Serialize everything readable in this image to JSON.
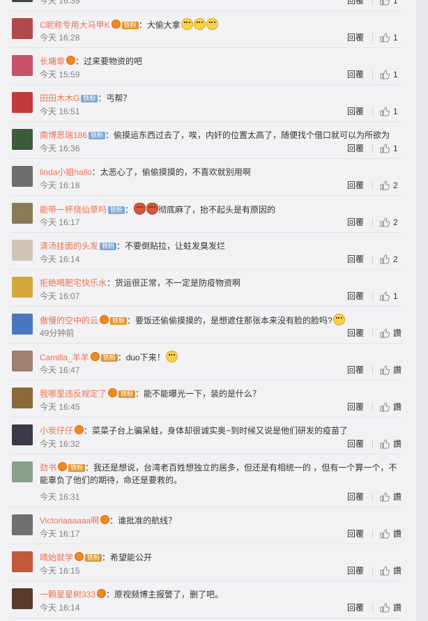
{
  "labels": {
    "reply": "回覆",
    "like_text": "讚"
  },
  "comments": [
    {
      "avatar_color": "#3b4a3e",
      "name": "",
      "vip": false,
      "fan": "",
      "text": "",
      "emoji": [],
      "time": "今天 16:39",
      "likes": "1",
      "like_style": "icon"
    },
    {
      "avatar_color": "#b04a4a",
      "name": "C昵称专用大马甲K",
      "vip": true,
      "fan": "铁粉",
      "fan_style": "gold",
      "text": "：大偷大拿",
      "emoji": [
        "surprised",
        "surprised",
        "surprised"
      ],
      "time": "今天 16:28",
      "likes": "1",
      "like_style": "icon"
    },
    {
      "avatar_color": "#c8516a",
      "name": "长墉章",
      "vip": true,
      "fan": "",
      "text": "：过来要物资的吧",
      "emoji": [],
      "time": "今天 15:59",
      "likes": "1",
      "like_style": "icon"
    },
    {
      "avatar_color": "#c23a3a",
      "name": "田田木木G",
      "vip": false,
      "fan": "铁粉",
      "fan_style": "iron",
      "text": "：丐帮？",
      "emoji": [],
      "time": "今天 16:51",
      "likes": "1",
      "like_style": "icon"
    },
    {
      "avatar_color": "#3d5a3a",
      "name": "南博思瑞186",
      "vip": false,
      "fan": "铁粉",
      "fan_style": "iron",
      "text": "：偷摸运东西过去了，唉，内奸的位置太高了，随便找个借口就可以为所欲为",
      "emoji": [],
      "time": "今天 16:36",
      "likes": "1",
      "like_style": "icon"
    },
    {
      "avatar_color": "#6d6d6d",
      "name": "linda小姐hallo",
      "vip": false,
      "fan": "",
      "text": "：太恶心了，偷偷摸摸的，不喜欢就别用啊",
      "emoji": [],
      "time": "今天 16:18",
      "likes": "2",
      "like_style": "icon"
    },
    {
      "avatar_color": "#8a7a5a",
      "name": "能带一杯烧仙草吗",
      "vip": false,
      "fan": "铁粉",
      "fan_style": "iron",
      "text": "彻底麻了，抬不起头是有原因的",
      "emoji_before": [
        "red",
        "red"
      ],
      "emoji": [],
      "time": "今天 16:17",
      "likes": "2",
      "like_style": "icon"
    },
    {
      "avatar_color": "#cfc6b8",
      "name": "清汤挂面的头发",
      "vip": false,
      "fan": "铁粉",
      "fan_style": "iron",
      "text": "：不要倒贴拉，让蛀发臭发烂",
      "emoji": [],
      "time": "今天 16:14",
      "likes": "2",
      "like_style": "icon"
    },
    {
      "avatar_color": "#d4a83a",
      "name": "拒绝喝肥宅快乐水",
      "vip": false,
      "fan": "",
      "text": "：货运很正常，不一定是防疫物资啊",
      "emoji": [],
      "time": "今天 16:07",
      "likes": "1",
      "like_style": "icon"
    },
    {
      "avatar_color": "#4a78c0",
      "name": "傲慢的空中的云",
      "vip": true,
      "fan": "铁粉",
      "fan_style": "gold",
      "text": "：要饭还偷偷摸摸的，是想遮住那张本来没有脸的脸吗?",
      "emoji": [
        "surprised"
      ],
      "time": "49分钟前",
      "likes": "讚",
      "like_style": "text"
    },
    {
      "avatar_color": "#a08070",
      "name": "Camilla_羊羊",
      "vip": true,
      "fan": "铁粉",
      "fan_style": "gold",
      "text": "：duo下来！",
      "emoji": [
        "surprised"
      ],
      "time": "今天 16:47",
      "likes": "讚",
      "like_style": "text"
    },
    {
      "avatar_color": "#8a6a3a",
      "name": "我哪里违反规定了",
      "vip": true,
      "fan": "铁粉",
      "fan_style": "gold",
      "text": "：能不能曝光一下，装的是什么？",
      "emoji": [],
      "time": "今天 16:45",
      "likes": "讚",
      "like_style": "text"
    },
    {
      "avatar_color": "#3a3a4a",
      "name": "小炭仔仔",
      "vip": true,
      "fan": "",
      "text": "：菜菜子台上骗呆蛙，身体却很诚实奥~到时候又说是他们研发的疫苗了",
      "emoji": [],
      "time": "今天 16:32",
      "likes": "讚",
      "like_style": "text"
    },
    {
      "avatar_color": "#8aa08a",
      "name": "劲书",
      "vip": true,
      "fan": "铁粉",
      "fan_style": "gold",
      "text": "：我还是想说，台湾老百姓想独立的居多，但还是有相统一的 ，但有一个算一个，不能辜负了他们的期待，命还是要救的。",
      "emoji": [],
      "time": "今天 16:31",
      "likes": "讚",
      "like_style": "text",
      "tall": true
    },
    {
      "avatar_color": "#707070",
      "name": "Victoriaaaaaa啊",
      "vip": true,
      "fan": "",
      "text": "：谁批准的航线？",
      "emoji": [],
      "time": "今天 16:17",
      "likes": "讚",
      "like_style": "text"
    },
    {
      "avatar_color": "#c05a3a",
      "name": "晴始就学",
      "vip": true,
      "fan": "铁粉",
      "fan_style": "gold",
      "text": "：希望能公开",
      "emoji": [],
      "time": "今天 16:15",
      "likes": "讚",
      "like_style": "text"
    },
    {
      "avatar_color": "#5a3a2a",
      "name": "一颗星星树333",
      "vip": true,
      "fan": "",
      "text": "：原视频博主报警了，删了吧。",
      "emoji": [],
      "time": "今天 16:14",
      "likes": "讚",
      "like_style": "text"
    }
  ]
}
